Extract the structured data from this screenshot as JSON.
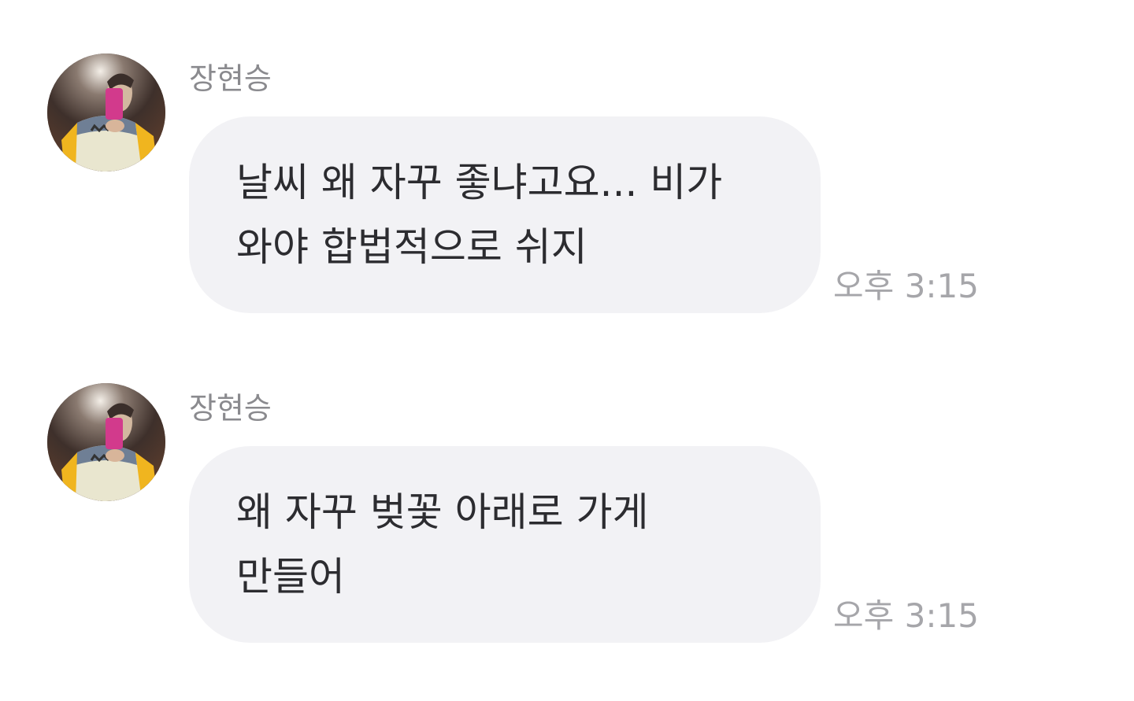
{
  "messages": [
    {
      "sender": "장현승",
      "text": "날씨 왜 자꾸 좋냐고요... 비가\n와야 합법적으로 쉬지",
      "time": "오후 3:15",
      "avatar_icon": "profile-photo-avatar"
    },
    {
      "sender": "장현승",
      "text": "왜 자꾸 벚꽃 아래로 가게\n만들어",
      "time": "오후 3:15",
      "avatar_icon": "profile-photo-avatar"
    }
  ],
  "colors": {
    "bubble_bg": "#f2f2f5",
    "sender_text": "#8a8a8e",
    "time_text": "#a6a6aa",
    "message_text": "#2c2c30"
  }
}
